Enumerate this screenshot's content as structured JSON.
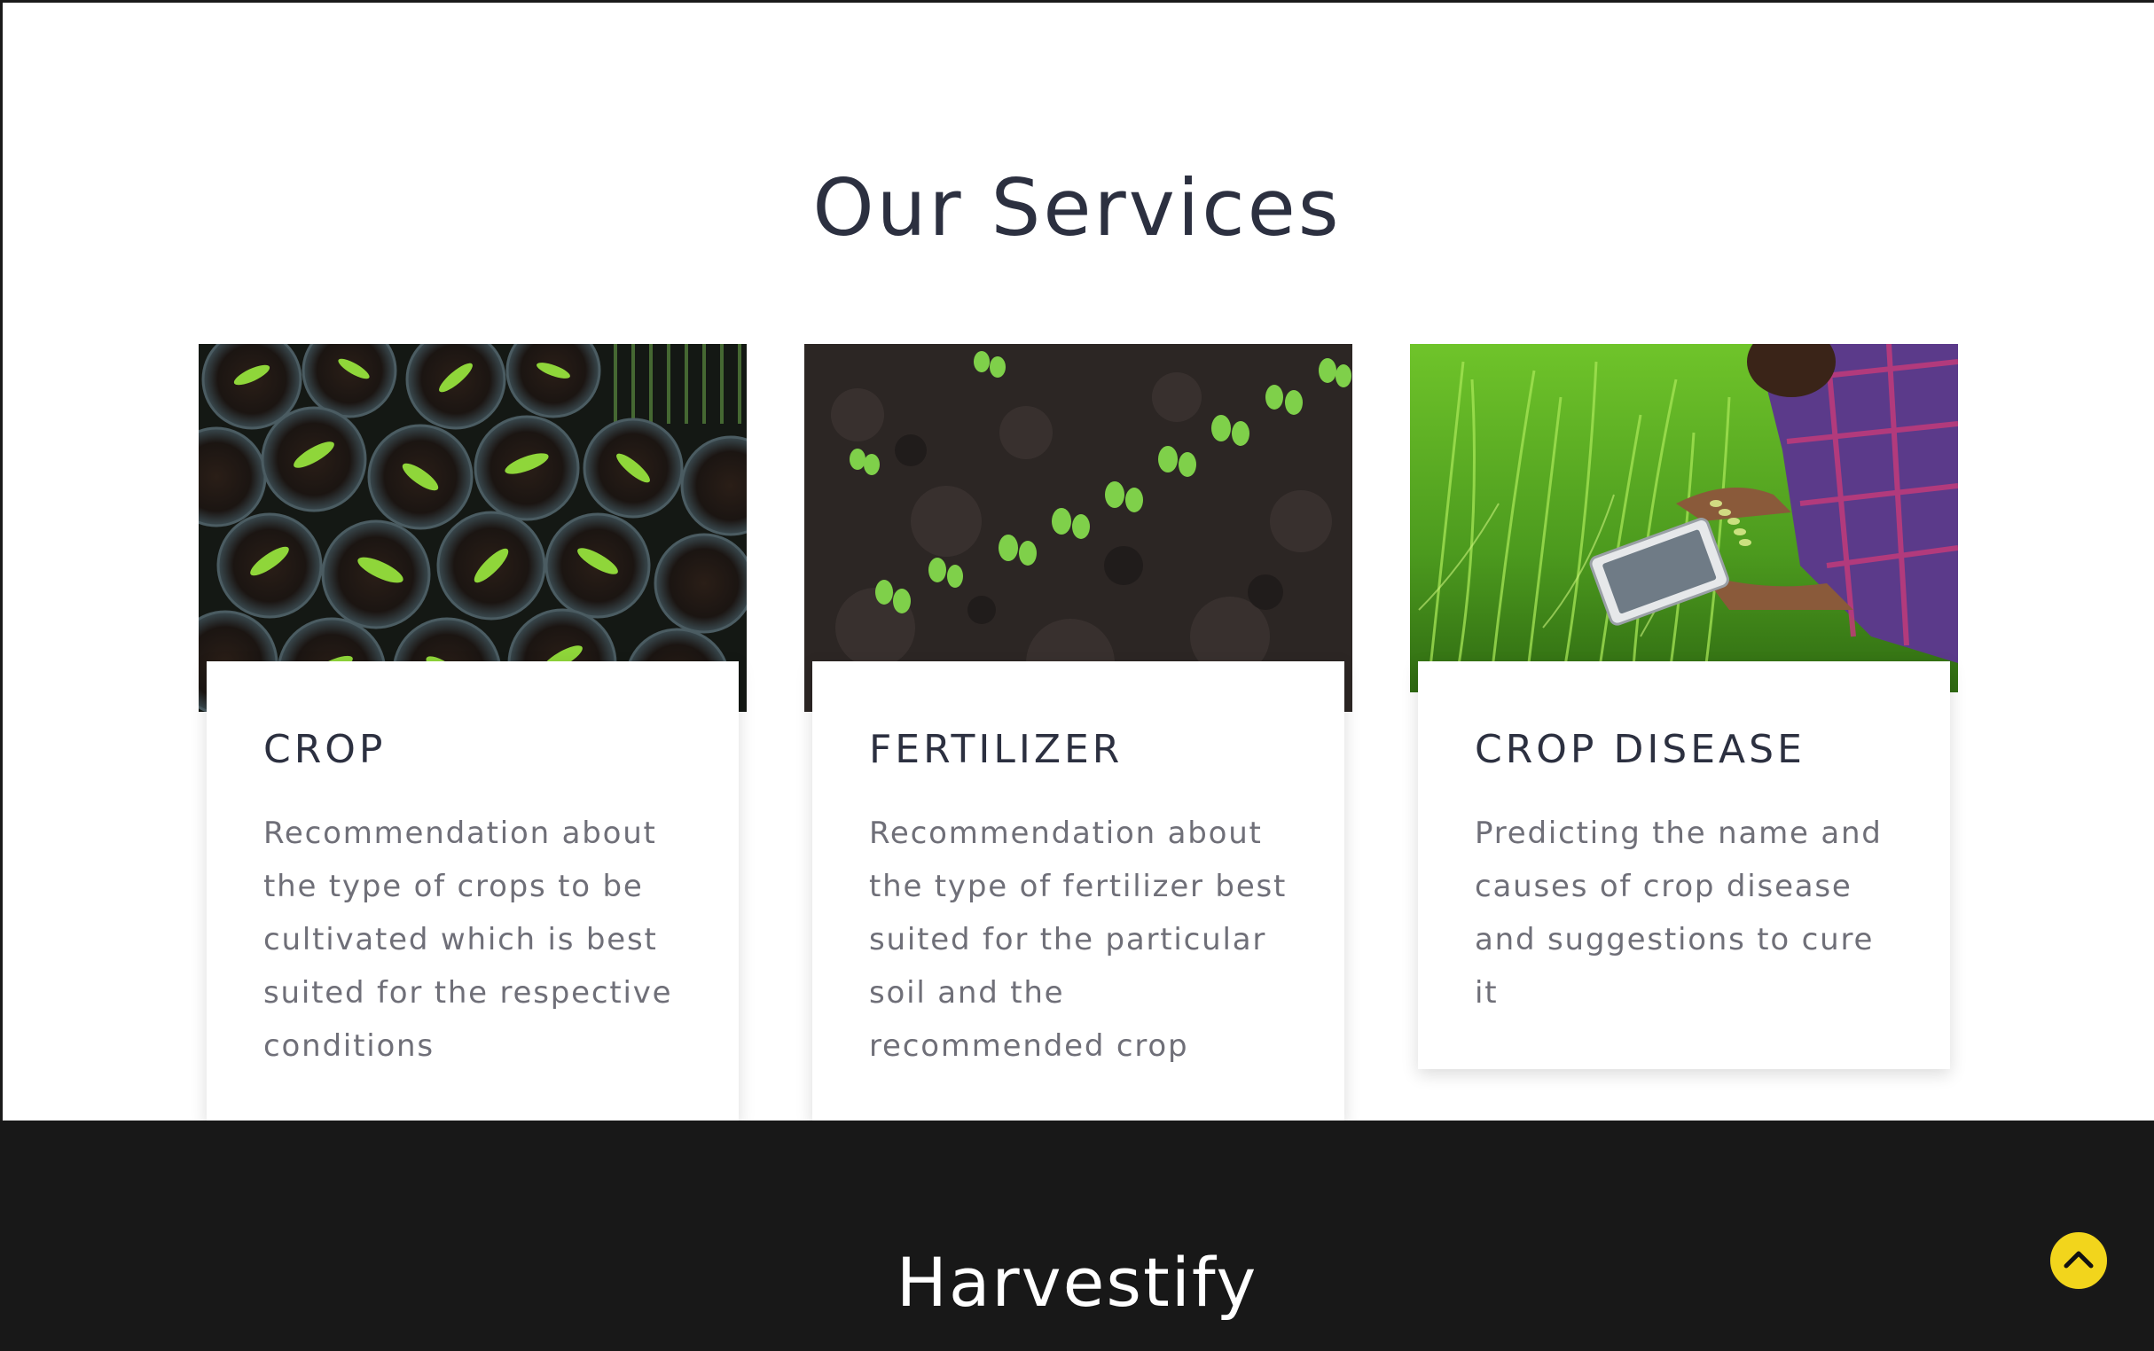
{
  "services": {
    "title": "Our Services",
    "items": [
      {
        "id": "crop",
        "image_subject": "seedlings-in-pots-photo",
        "heading": "CROP",
        "description": "Recommendation about the type of crops to be cultivated which is best suited for the respective conditions"
      },
      {
        "id": "fertilizer",
        "image_subject": "sprouts-in-soil-photo",
        "heading": "FERTILIZER",
        "description": "Recommendation about the type of fertilizer best suited for the particular soil and the recommended crop"
      },
      {
        "id": "crop-disease",
        "image_subject": "farmer-with-tablet-in-rice-field-photo",
        "heading": "CROP DISEASE",
        "description": "Predicting the name and causes of crop disease and suggestions to cure it"
      }
    ]
  },
  "footer": {
    "brand": "Harvestify"
  },
  "back_to_top": {
    "icon": "chevron-up-icon"
  },
  "colors": {
    "heading": "#2c3040",
    "body_text": "#6f6f78",
    "footer_bg": "#181818",
    "accent_yellow": "#f2d51c"
  }
}
